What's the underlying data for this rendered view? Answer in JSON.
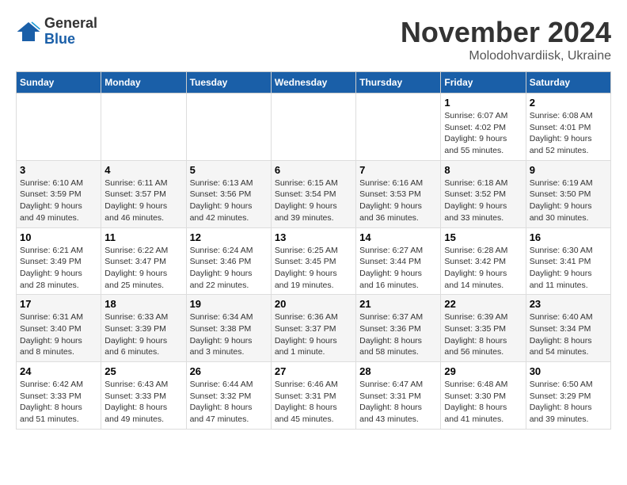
{
  "logo": {
    "general": "General",
    "blue": "Blue"
  },
  "header": {
    "month": "November 2024",
    "location": "Molodohvardiisk, Ukraine"
  },
  "weekdays": [
    "Sunday",
    "Monday",
    "Tuesday",
    "Wednesday",
    "Thursday",
    "Friday",
    "Saturday"
  ],
  "weeks": [
    [
      {
        "day": "",
        "info": ""
      },
      {
        "day": "",
        "info": ""
      },
      {
        "day": "",
        "info": ""
      },
      {
        "day": "",
        "info": ""
      },
      {
        "day": "",
        "info": ""
      },
      {
        "day": "1",
        "info": "Sunrise: 6:07 AM\nSunset: 4:02 PM\nDaylight: 9 hours and 55 minutes."
      },
      {
        "day": "2",
        "info": "Sunrise: 6:08 AM\nSunset: 4:01 PM\nDaylight: 9 hours and 52 minutes."
      }
    ],
    [
      {
        "day": "3",
        "info": "Sunrise: 6:10 AM\nSunset: 3:59 PM\nDaylight: 9 hours and 49 minutes."
      },
      {
        "day": "4",
        "info": "Sunrise: 6:11 AM\nSunset: 3:57 PM\nDaylight: 9 hours and 46 minutes."
      },
      {
        "day": "5",
        "info": "Sunrise: 6:13 AM\nSunset: 3:56 PM\nDaylight: 9 hours and 42 minutes."
      },
      {
        "day": "6",
        "info": "Sunrise: 6:15 AM\nSunset: 3:54 PM\nDaylight: 9 hours and 39 minutes."
      },
      {
        "day": "7",
        "info": "Sunrise: 6:16 AM\nSunset: 3:53 PM\nDaylight: 9 hours and 36 minutes."
      },
      {
        "day": "8",
        "info": "Sunrise: 6:18 AM\nSunset: 3:52 PM\nDaylight: 9 hours and 33 minutes."
      },
      {
        "day": "9",
        "info": "Sunrise: 6:19 AM\nSunset: 3:50 PM\nDaylight: 9 hours and 30 minutes."
      }
    ],
    [
      {
        "day": "10",
        "info": "Sunrise: 6:21 AM\nSunset: 3:49 PM\nDaylight: 9 hours and 28 minutes."
      },
      {
        "day": "11",
        "info": "Sunrise: 6:22 AM\nSunset: 3:47 PM\nDaylight: 9 hours and 25 minutes."
      },
      {
        "day": "12",
        "info": "Sunrise: 6:24 AM\nSunset: 3:46 PM\nDaylight: 9 hours and 22 minutes."
      },
      {
        "day": "13",
        "info": "Sunrise: 6:25 AM\nSunset: 3:45 PM\nDaylight: 9 hours and 19 minutes."
      },
      {
        "day": "14",
        "info": "Sunrise: 6:27 AM\nSunset: 3:44 PM\nDaylight: 9 hours and 16 minutes."
      },
      {
        "day": "15",
        "info": "Sunrise: 6:28 AM\nSunset: 3:42 PM\nDaylight: 9 hours and 14 minutes."
      },
      {
        "day": "16",
        "info": "Sunrise: 6:30 AM\nSunset: 3:41 PM\nDaylight: 9 hours and 11 minutes."
      }
    ],
    [
      {
        "day": "17",
        "info": "Sunrise: 6:31 AM\nSunset: 3:40 PM\nDaylight: 9 hours and 8 minutes."
      },
      {
        "day": "18",
        "info": "Sunrise: 6:33 AM\nSunset: 3:39 PM\nDaylight: 9 hours and 6 minutes."
      },
      {
        "day": "19",
        "info": "Sunrise: 6:34 AM\nSunset: 3:38 PM\nDaylight: 9 hours and 3 minutes."
      },
      {
        "day": "20",
        "info": "Sunrise: 6:36 AM\nSunset: 3:37 PM\nDaylight: 9 hours and 1 minute."
      },
      {
        "day": "21",
        "info": "Sunrise: 6:37 AM\nSunset: 3:36 PM\nDaylight: 8 hours and 58 minutes."
      },
      {
        "day": "22",
        "info": "Sunrise: 6:39 AM\nSunset: 3:35 PM\nDaylight: 8 hours and 56 minutes."
      },
      {
        "day": "23",
        "info": "Sunrise: 6:40 AM\nSunset: 3:34 PM\nDaylight: 8 hours and 54 minutes."
      }
    ],
    [
      {
        "day": "24",
        "info": "Sunrise: 6:42 AM\nSunset: 3:33 PM\nDaylight: 8 hours and 51 minutes."
      },
      {
        "day": "25",
        "info": "Sunrise: 6:43 AM\nSunset: 3:33 PM\nDaylight: 8 hours and 49 minutes."
      },
      {
        "day": "26",
        "info": "Sunrise: 6:44 AM\nSunset: 3:32 PM\nDaylight: 8 hours and 47 minutes."
      },
      {
        "day": "27",
        "info": "Sunrise: 6:46 AM\nSunset: 3:31 PM\nDaylight: 8 hours and 45 minutes."
      },
      {
        "day": "28",
        "info": "Sunrise: 6:47 AM\nSunset: 3:31 PM\nDaylight: 8 hours and 43 minutes."
      },
      {
        "day": "29",
        "info": "Sunrise: 6:48 AM\nSunset: 3:30 PM\nDaylight: 8 hours and 41 minutes."
      },
      {
        "day": "30",
        "info": "Sunrise: 6:50 AM\nSunset: 3:29 PM\nDaylight: 8 hours and 39 minutes."
      }
    ]
  ]
}
